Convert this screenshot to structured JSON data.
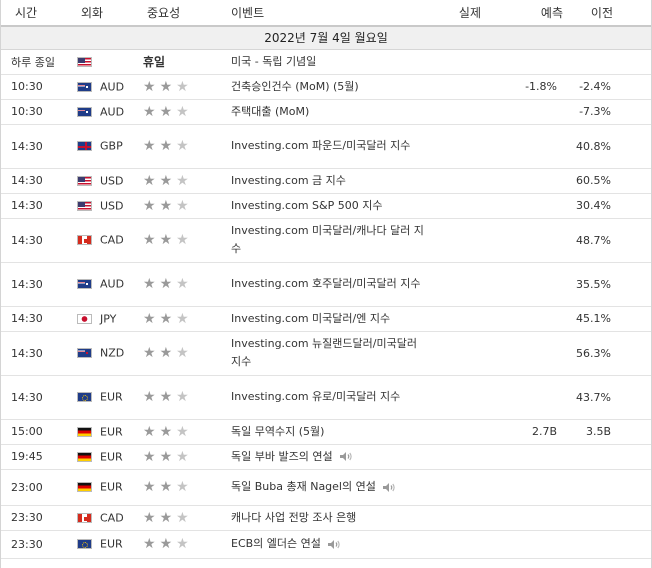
{
  "columns": {
    "time": "시간",
    "currency": "외화",
    "importance": "중요성",
    "event": "이벤트",
    "actual": "실제",
    "forecast": "예측",
    "previous": "이전"
  },
  "date_header": "2022년 7월 4일 월요일",
  "holiday_row": {
    "time": "하루 종일",
    "currency_flag": "us-flag-icon",
    "importance": "휴일",
    "event": "미국 - 독립 기념일"
  },
  "events": [
    {
      "time": "10:30",
      "flag": "au",
      "currency": "AUD",
      "stars": 2,
      "event": "건축승인건수 (MoM) (5월)",
      "actual": "",
      "forecast": "-1.8%",
      "previous": "-2.4%",
      "speech": false
    },
    {
      "time": "10:30",
      "flag": "au",
      "currency": "AUD",
      "stars": 2,
      "event": "주택대출 (MoM)",
      "actual": "",
      "forecast": "",
      "previous": "-7.3%",
      "speech": false
    },
    {
      "time": "14:30",
      "flag": "gb",
      "currency": "GBP",
      "stars": 2,
      "event": "Investing.com 파운드/미국달러 지수",
      "actual": "",
      "forecast": "",
      "previous": "40.8%",
      "speech": false
    },
    {
      "time": "14:30",
      "flag": "us",
      "currency": "USD",
      "stars": 2,
      "event": "Investing.com 금 지수",
      "actual": "",
      "forecast": "",
      "previous": "60.5%",
      "speech": false
    },
    {
      "time": "14:30",
      "flag": "us",
      "currency": "USD",
      "stars": 2,
      "event": "Investing.com S&P 500 지수",
      "actual": "",
      "forecast": "",
      "previous": "30.4%",
      "speech": false
    },
    {
      "time": "14:30",
      "flag": "ca",
      "currency": "CAD",
      "stars": 2,
      "event": "Investing.com 미국달러/캐나다 달러 지수",
      "actual": "",
      "forecast": "",
      "previous": "48.7%",
      "speech": false
    },
    {
      "time": "14:30",
      "flag": "au",
      "currency": "AUD",
      "stars": 2,
      "event": "Investing.com 호주달러/미국달러 지수",
      "actual": "",
      "forecast": "",
      "previous": "35.5%",
      "speech": false
    },
    {
      "time": "14:30",
      "flag": "jp",
      "currency": "JPY",
      "stars": 2,
      "event": "Investing.com 미국달러/엔 지수",
      "actual": "",
      "forecast": "",
      "previous": "45.1%",
      "speech": false
    },
    {
      "time": "14:30",
      "flag": "nz",
      "currency": "NZD",
      "stars": 2,
      "event": "Investing.com 뉴질랜드달러/미국달러 지수",
      "actual": "",
      "forecast": "",
      "previous": "56.3%",
      "speech": false
    },
    {
      "time": "14:30",
      "flag": "eu",
      "currency": "EUR",
      "stars": 2,
      "event": "Investing.com 유로/미국달러 지수",
      "actual": "",
      "forecast": "",
      "previous": "43.7%",
      "speech": false
    },
    {
      "time": "15:00",
      "flag": "de",
      "currency": "EUR",
      "stars": 2,
      "event": "독일 무역수지 (5월)",
      "actual": "",
      "forecast": "2.7B",
      "previous": "3.5B",
      "speech": false
    },
    {
      "time": "19:45",
      "flag": "de",
      "currency": "EUR",
      "stars": 2,
      "event": "독일 부바 발즈의 연설",
      "actual": "",
      "forecast": "",
      "previous": "",
      "speech": true
    },
    {
      "time": "23:00",
      "flag": "de",
      "currency": "EUR",
      "stars": 2,
      "event": "독일 Buba 총재 Nagel의 연설",
      "actual": "",
      "forecast": "",
      "previous": "",
      "speech": true
    },
    {
      "time": "23:30",
      "flag": "ca",
      "currency": "CAD",
      "stars": 2,
      "event": "캐나다 사업 전망 조사 은행",
      "actual": "",
      "forecast": "",
      "previous": "",
      "speech": false
    },
    {
      "time": "23:30",
      "flag": "eu",
      "currency": "EUR",
      "stars": 2,
      "event": "ECB의 엘더슨 연설",
      "actual": "",
      "forecast": "",
      "previous": "",
      "speech": true
    }
  ],
  "colors": {
    "header_border": "#c9c9c9",
    "date_bg": "#f0f0f0",
    "star_on": "#9a9a9a",
    "star_off": "#c4c4c4"
  }
}
